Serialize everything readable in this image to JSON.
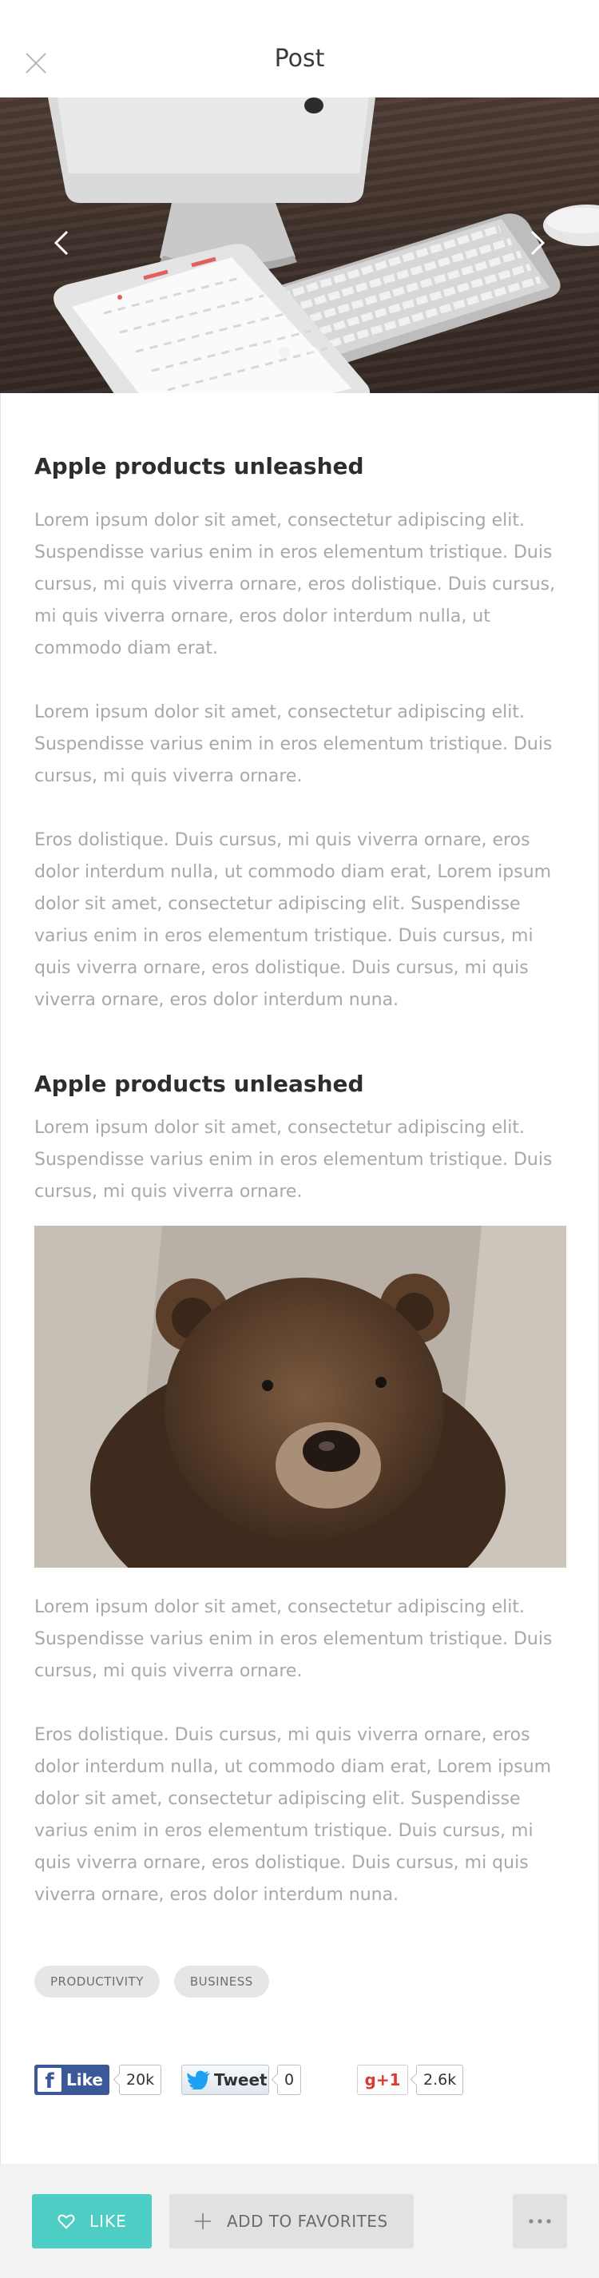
{
  "header": {
    "title": "Post",
    "close_icon": "close-icon"
  },
  "carousel": {
    "prev_icon": "chevron-left-icon",
    "next_icon": "chevron-right-icon",
    "slide_count": 2,
    "active_slide": 1
  },
  "article": {
    "section1": {
      "heading": "Apple products unleashed",
      "paragraphs": [
        "Lorem ipsum dolor sit amet, consectetur adipiscing elit. Suspendisse varius enim in eros elementum tristique. Duis cursus, mi quis viverra ornare, eros dolistique. Duis cursus, mi quis viverra ornare, eros dolor interdum nulla, ut commodo diam erat.",
        "Lorem ipsum dolor sit amet, consectetur adipiscing elit. Suspendisse varius enim in eros elementum tristique. Duis cursus, mi quis viverra ornare.",
        "Eros dolistique. Duis cursus, mi quis viverra ornare, eros dolor interdum nulla, ut commodo diam erat, Lorem ipsum dolor sit amet, consectetur adipiscing elit. Suspendisse varius enim in eros elementum tristique. Duis cursus, mi quis viverra ornare, eros dolistique. Duis cursus, mi quis viverra ornare, eros dolor interdum nuna."
      ]
    },
    "section2": {
      "heading": "Apple products unleashed",
      "intro": "Lorem ipsum dolor sit amet, consectetur adipiscing elit. Suspendisse varius enim in eros elementum tristique. Duis cursus, mi quis viverra ornare.",
      "after_image": [
        "Lorem ipsum dolor sit amet, consectetur adipiscing elit. Suspendisse varius enim in eros elementum tristique. Duis cursus, mi quis viverra ornare.",
        "Eros dolistique. Duis cursus, mi quis viverra ornare, eros dolor interdum nulla, ut commodo diam erat, Lorem ipsum dolor sit amet, consectetur adipiscing elit. Suspendisse varius enim in eros elementum tristique. Duis cursus, mi quis viverra ornare, eros dolistique. Duis cursus, mi quis viverra ornare, eros dolor interdum nuna."
      ]
    },
    "tags": [
      "PRODUCTIVITY",
      "BUSINESS"
    ]
  },
  "social": {
    "facebook": {
      "label": "Like",
      "count": "20k"
    },
    "twitter": {
      "label": "Tweet",
      "count": "0"
    },
    "gplus": {
      "label": "+1",
      "count": "2.6k"
    }
  },
  "actions": {
    "like_label": "LIKE",
    "favorites_label": "ADD TO FAVORITES"
  },
  "colors": {
    "accent": "#4ecdc4",
    "facebook": "#3b5998",
    "twitter": "#1da1f2",
    "gplus": "#d73d32"
  }
}
